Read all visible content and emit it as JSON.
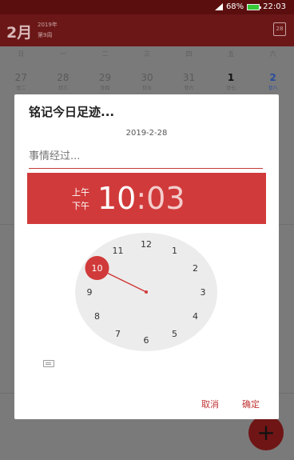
{
  "status_bar": {
    "battery": "68%",
    "time": "22:03"
  },
  "app_bar": {
    "month": "2月",
    "year": "2019年",
    "week": "第9周",
    "calendar_day": "28"
  },
  "calendar": {
    "weekdays": [
      "日",
      "一",
      "二",
      "三",
      "四",
      "五",
      "六"
    ],
    "dates": [
      {
        "n": "27",
        "sub": "廿二"
      },
      {
        "n": "28",
        "sub": "廿三"
      },
      {
        "n": "29",
        "sub": "廿四"
      },
      {
        "n": "30",
        "sub": "廿五"
      },
      {
        "n": "31",
        "sub": "廿六"
      },
      {
        "n": "1",
        "sub": "廿七"
      },
      {
        "n": "2",
        "sub": "廿八"
      }
    ]
  },
  "dialog": {
    "title": "铭记今日足迹...",
    "date": "2019-2-28",
    "input_placeholder": "事情经过...",
    "am_label": "上午",
    "pm_label": "下午",
    "hour": "10",
    "colon": ":",
    "minute": "03",
    "clock_numbers": [
      "12",
      "1",
      "2",
      "3",
      "4",
      "5",
      "6",
      "7",
      "8",
      "9",
      "10",
      "11"
    ],
    "selected_hour": "10",
    "cancel_label": "取消",
    "ok_label": "确定"
  },
  "fab": {
    "label": "+"
  },
  "colors": {
    "accent": "#d13a3a",
    "dim_bar": "#6b1717",
    "clock_face": "#ececec"
  },
  "icons": {
    "keyboard": "keyboard-icon",
    "calendar": "calendar-icon",
    "add": "add-icon"
  }
}
